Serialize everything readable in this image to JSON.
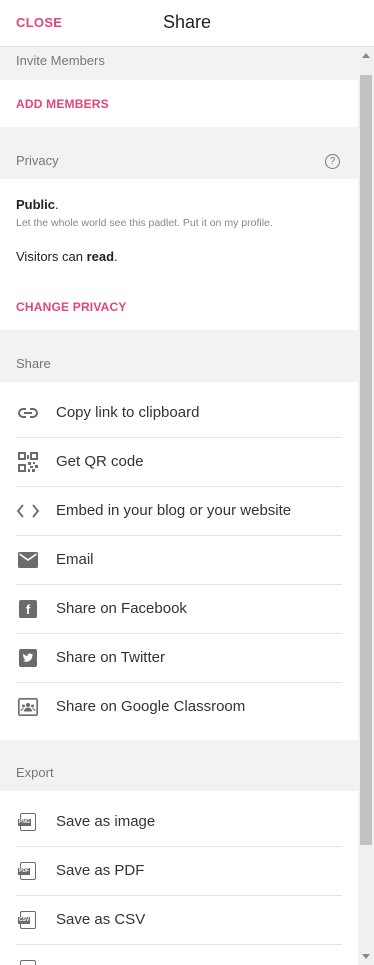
{
  "header": {
    "close_label": "CLOSE",
    "title": "Share"
  },
  "invite": {
    "heading": "Invite Members",
    "add_label": "ADD MEMBERS"
  },
  "privacy": {
    "heading": "Privacy",
    "level": "Public",
    "level_suffix": ".",
    "description": "Let the whole world see this padlet. Put it on my profile.",
    "visitors_prefix": "Visitors can ",
    "visitors_permission": "read",
    "visitors_suffix": ".",
    "change_label": "CHANGE PRIVACY"
  },
  "share": {
    "heading": "Share",
    "items": [
      {
        "icon": "link-icon",
        "label": "Copy link to clipboard"
      },
      {
        "icon": "qr-code-icon",
        "label": "Get QR code"
      },
      {
        "icon": "embed-code-icon",
        "label": "Embed in your blog or your website"
      },
      {
        "icon": "email-icon",
        "label": "Email"
      },
      {
        "icon": "facebook-icon",
        "label": "Share on Facebook"
      },
      {
        "icon": "twitter-icon",
        "label": "Share on Twitter"
      },
      {
        "icon": "google-classroom-icon",
        "label": "Share on Google Classroom"
      }
    ]
  },
  "export": {
    "heading": "Export",
    "items": [
      {
        "icon": "png-file-icon",
        "icon_text": "PNG",
        "label": "Save as image"
      },
      {
        "icon": "pdf-file-icon",
        "icon_text": "PDF",
        "label": "Save as PDF"
      },
      {
        "icon": "csv-file-icon",
        "icon_text": "CSV",
        "label": "Save as CSV"
      }
    ]
  },
  "colors": {
    "accent": "#e0457b",
    "icon": "#6b6b6b",
    "section_bg": "#f2f2f2"
  }
}
